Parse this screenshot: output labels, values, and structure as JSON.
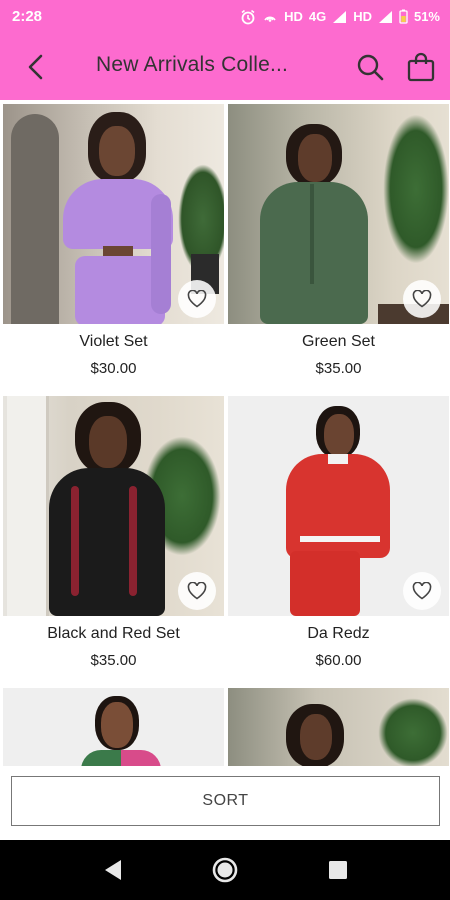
{
  "status": {
    "time": "2:28",
    "hd1": "HD",
    "network": "4G",
    "hd2": "HD",
    "battery": "51%"
  },
  "header": {
    "title": "New Arrivals Colle..."
  },
  "products": [
    {
      "name": "Violet Set",
      "price": "$30.00"
    },
    {
      "name": "Green Set",
      "price": "$35.00"
    },
    {
      "name": "Black and Red Set",
      "price": "$35.00"
    },
    {
      "name": "Da Redz",
      "price": "$60.00"
    },
    {
      "name": "",
      "price": ""
    },
    {
      "name": "",
      "price": ""
    }
  ],
  "sort": {
    "label": "SORT"
  },
  "colors": {
    "header_bg": "#fd6bcf",
    "violet": "#b48be0",
    "green": "#4b6a4e",
    "black": "#1b1b1b",
    "red": "#d8342f"
  },
  "icons": [
    "back-arrow-icon",
    "search-icon",
    "shopping-bag-icon",
    "heart-icon",
    "nav-back-icon",
    "nav-home-icon",
    "nav-recents-icon"
  ]
}
